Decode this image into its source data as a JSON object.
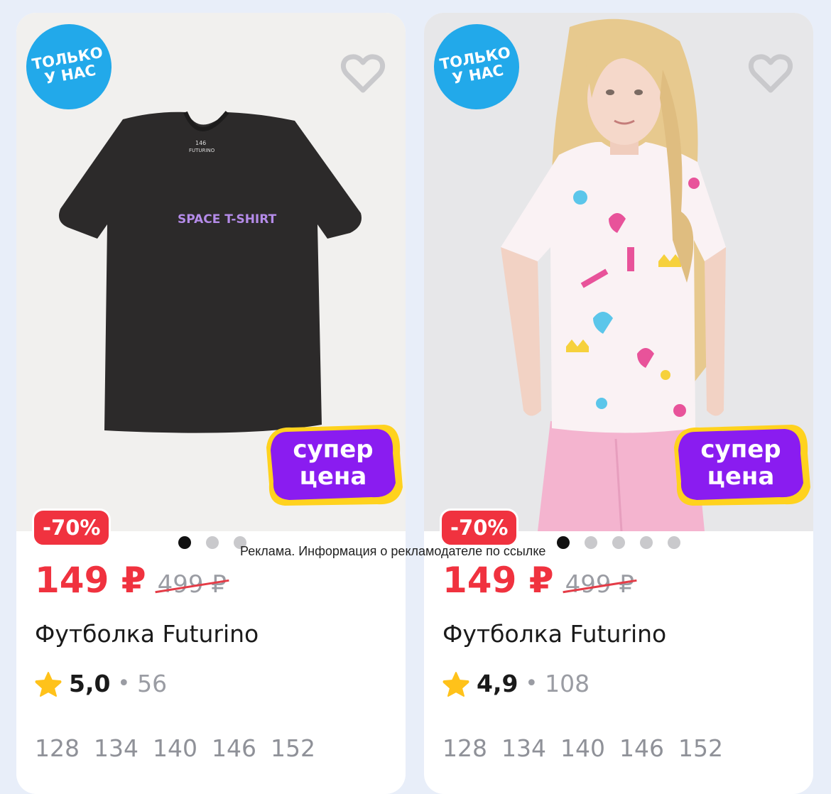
{
  "cards": [
    {
      "badge_only": "ТОЛЬКО\nУ НАС",
      "super_price_badge": "супер\nцена",
      "discount": "-70%",
      "price": "149 ₽",
      "old_price": "499 ₽",
      "title": "Футболка Futurino",
      "rating": "5,0",
      "reviews": "56",
      "sizes": [
        "128",
        "134",
        "140",
        "146",
        "152"
      ],
      "image_count": 3,
      "active_image": 0,
      "print_text": "SPACE T-SHIRT",
      "label_size": "146",
      "label_brand": "FUTURINO"
    },
    {
      "badge_only": "ТОЛЬКО\nУ НАС",
      "super_price_badge": "супер\nцена",
      "discount": "-70%",
      "price": "149 ₽",
      "old_price": "499 ₽",
      "title": "Футболка Futurino",
      "rating": "4,9",
      "reviews": "108",
      "sizes": [
        "128",
        "134",
        "140",
        "146",
        "152"
      ],
      "image_count": 5,
      "active_image": 0
    }
  ],
  "ad_note": "Реклама. Информация о рекламодателе по ссылке",
  "rating_separator": "•",
  "icons": {
    "favorite": "heart-outline-icon",
    "rating": "star-icon"
  },
  "colors": {
    "price": "#f0323f",
    "badge_blue": "#22a9ea",
    "super_purple": "#8a1cf0",
    "super_yellow": "#ffd21e",
    "star": "#ffc21a"
  }
}
